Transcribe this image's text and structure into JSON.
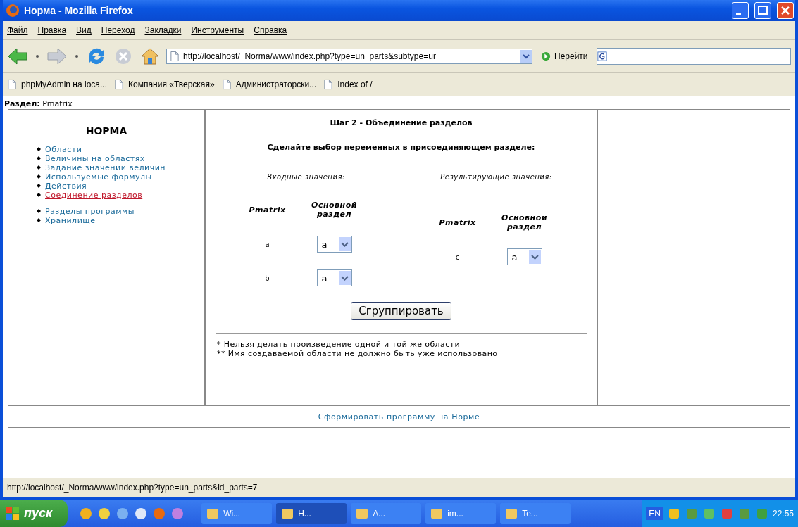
{
  "window": {
    "title": "Норма - Mozilla Firefox"
  },
  "menu": [
    "Файл",
    "Правка",
    "Вид",
    "Переход",
    "Закладки",
    "Инструменты",
    "Справка"
  ],
  "toolbar": {
    "url": "http://localhost/_Norma/www/index.php?type=un_parts&subtype=ur",
    "go_button": "Перейти"
  },
  "bookmarks": [
    "phpMyAdmin на loca...",
    "Компания «Тверская»",
    "Администраторски...",
    "Index of /"
  ],
  "section_label": "**Раздел:** Pmatrix",
  "sidebar": {
    "title": "НОРМА",
    "groups": [
      [
        {
          "label": "Области",
          "selected": false
        },
        {
          "label": "Величины на областях",
          "selected": false
        },
        {
          "label": "Задание значений величин",
          "selected": false
        },
        {
          "label": "Используемые формулы",
          "selected": false
        },
        {
          "label": "Действия",
          "selected": false
        },
        {
          "label": "Соединение разделов",
          "selected": true
        }
      ],
      [
        {
          "label": "Разделы программы",
          "selected": false
        },
        {
          "label": "Хранилище",
          "selected": false
        }
      ]
    ]
  },
  "main": {
    "heading": "Шаг 2 - Объединение разделов",
    "subheading": "Сделайте выбор переменных в присоединяющем разделе:",
    "input": {
      "label": "Входные значения:",
      "columns": [
        "Pmatrix",
        "Основной раздел"
      ],
      "rows": [
        {
          "variable": "a",
          "value": "a"
        },
        {
          "variable": "b",
          "value": "a"
        }
      ]
    },
    "result": {
      "label": "Результирующие значения:",
      "columns": [
        "Pmatrix",
        "Основной раздел"
      ],
      "rows": [
        {
          "variable": "c",
          "value": "a"
        }
      ]
    },
    "button": "Сгруппировать",
    "notes": [
      "* Нельзя делать произведение одной и той же области",
      "** Имя создаваемой области не должно быть уже использовано"
    ]
  },
  "footer_link": "Сформировать программу на Норме",
  "status_bar": "http://localhost/_Norma/www/index.php?type=un_parts&id_parts=7",
  "taskbar": {
    "start": "пуск",
    "tasks": [
      {
        "label": "Wi...",
        "selected": false
      },
      {
        "label": "Н...",
        "selected": true
      },
      {
        "label": "А...",
        "selected": false
      },
      {
        "label": "im...",
        "selected": false
      },
      {
        "label": "Te...",
        "selected": false
      }
    ],
    "language": "EN",
    "clock": "22:55"
  }
}
